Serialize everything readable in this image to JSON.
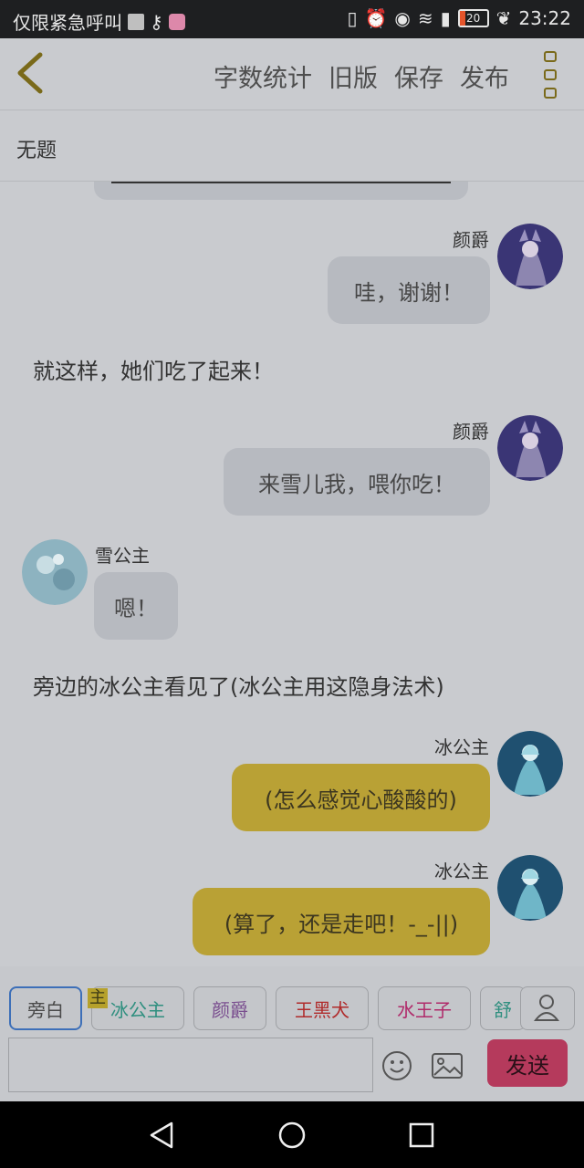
{
  "status_bar": {
    "carrier_text": "仅限紧急呼叫",
    "battery": "20",
    "time": "23:22"
  },
  "toolbar": {
    "word_count": "字数统计",
    "old_version": "旧版",
    "save": "保存",
    "publish": "发布"
  },
  "doc_title": "无题",
  "messages": [
    {
      "type": "right",
      "speaker": "颜爵",
      "text": "哇，谢谢！"
    },
    {
      "type": "narration",
      "text": "就这样，她们吃了起来！"
    },
    {
      "type": "right",
      "speaker": "颜爵",
      "text": "来雪儿我，喂你吃！"
    },
    {
      "type": "left",
      "speaker": "雪公主",
      "text": "嗯！"
    },
    {
      "type": "narration",
      "text": "旁边的冰公主看见了(冰公主用这隐身法术)"
    },
    {
      "type": "right",
      "speaker": "冰公主",
      "text": "(怎么感觉心酸酸的)"
    },
    {
      "type": "right",
      "speaker": "冰公主",
      "text": "(算了，还是走吧！-_-||)"
    }
  ],
  "characters": [
    {
      "label": "旁白",
      "color": "#4a4a4a"
    },
    {
      "label": "冰公主",
      "color": "#2f8f7f"
    },
    {
      "label": "颜爵",
      "color": "#7a4e8f"
    },
    {
      "label": "王黑犬",
      "color": "#b02a2a"
    },
    {
      "label": "水王子",
      "color": "#b02a6a"
    },
    {
      "label": "舒",
      "color": "#2f8f7f"
    }
  ],
  "main_tag": "主",
  "send_label": "发送",
  "colors": {
    "accent_yellow": "#b9a135",
    "send": "#b53a5c",
    "selected_border": "#3d6fb8"
  }
}
